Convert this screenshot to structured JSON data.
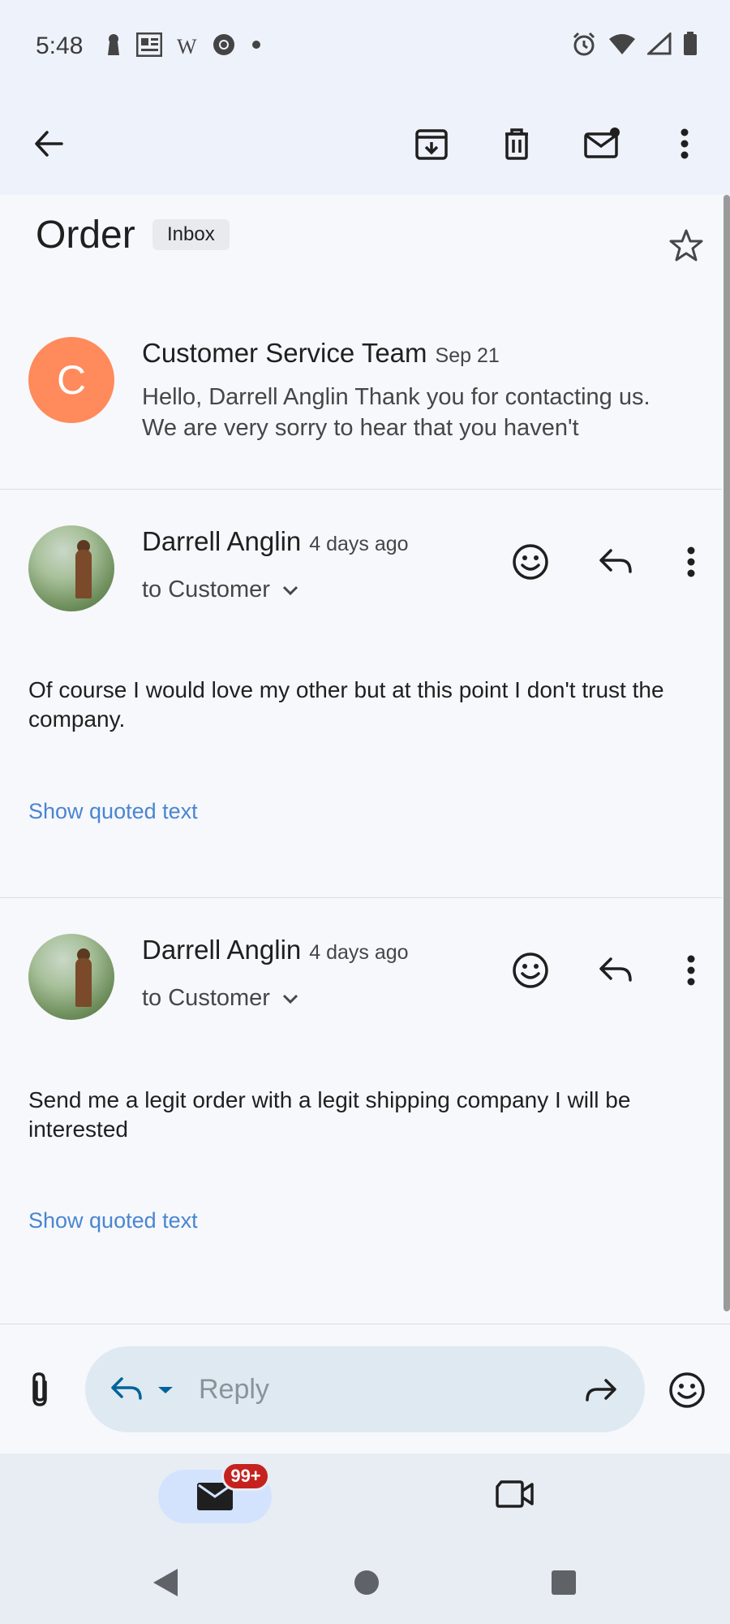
{
  "status_bar": {
    "time": "5:48",
    "left_icons": [
      "keyhole-icon",
      "news-icon",
      "w-icon",
      "chrome-icon",
      "dot-icon"
    ],
    "w_text": "W",
    "right_icons": [
      "alarm-icon",
      "wifi-icon",
      "signal-icon",
      "battery-icon"
    ]
  },
  "toolbar": {
    "actions": [
      "back-icon",
      "archive-icon",
      "delete-icon",
      "mark-unread-icon",
      "more-vert-icon"
    ]
  },
  "thread": {
    "subject": "Order",
    "label": "Inbox"
  },
  "messages": [
    {
      "avatar_letter": "C",
      "avatar_color": "#ff8a5c",
      "sender": "Customer Service Team",
      "date": "Sep 21",
      "snippet": "Hello, Darrell Anglin Thank you for contacting us. We are very sorry to hear that you haven't"
    },
    {
      "sender": "Darrell Anglin",
      "date": "4 days ago",
      "recipient": "to Customer",
      "body": "Of course I would love my other but at this point I don't trust the company.",
      "quoted_link": "Show quoted text"
    },
    {
      "sender": "Darrell Anglin",
      "date": "4 days ago",
      "recipient": "to Customer",
      "body": "Send me a legit order with a legit shipping company I will be interested",
      "quoted_link": "Show quoted text"
    }
  ],
  "reply_bar": {
    "placeholder": "Reply"
  },
  "bottom_nav": {
    "mail_badge": "99+",
    "accent": "#d3e3fd",
    "badge_color": "#c5221f"
  }
}
